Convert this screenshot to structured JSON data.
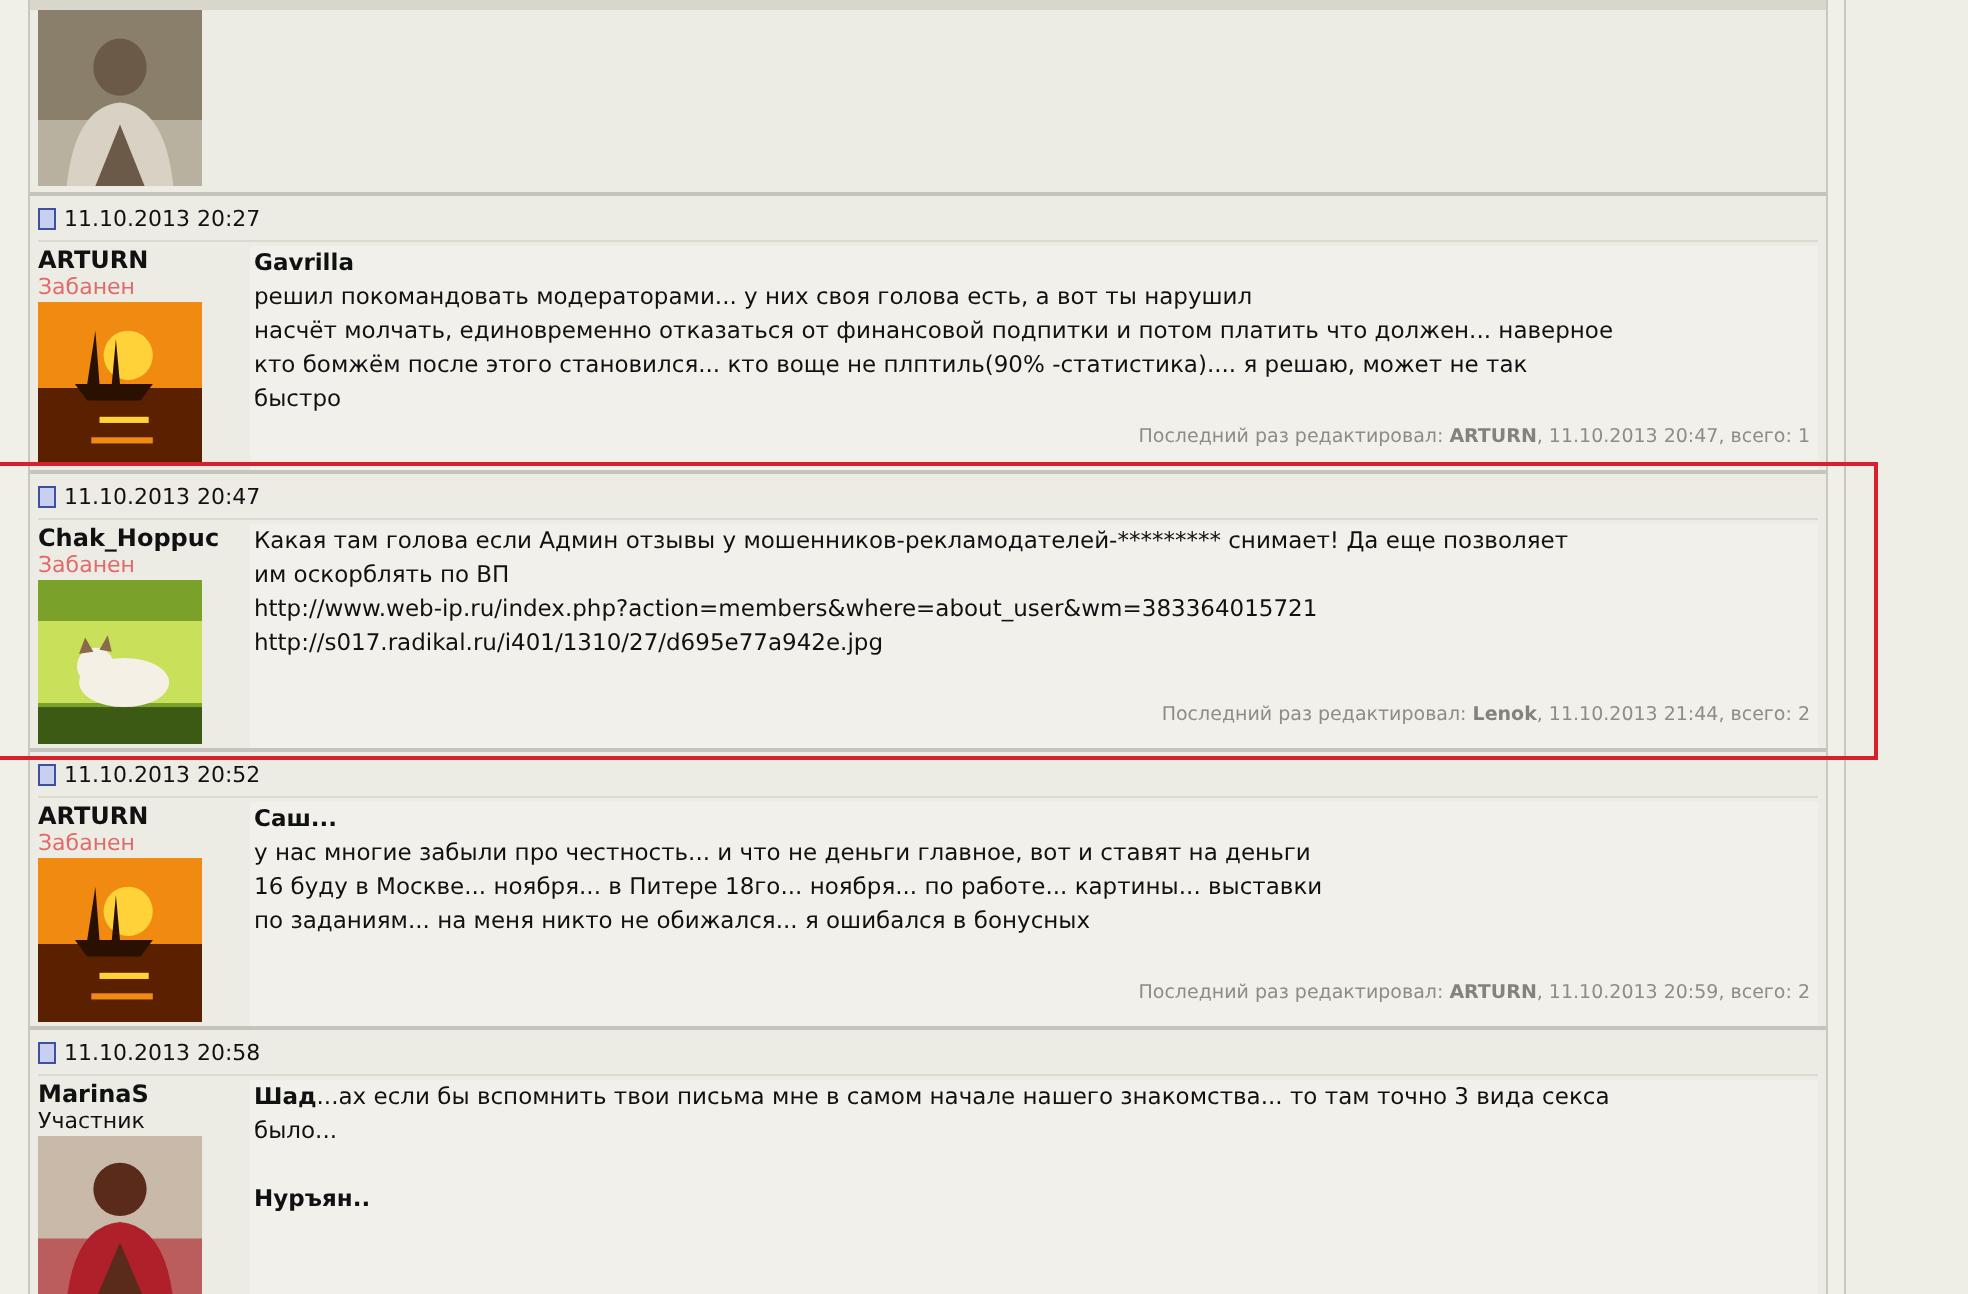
{
  "posts": [
    {
      "kind": "avatar_only"
    },
    {
      "kind": "post",
      "date": "11.10.2013 20:27",
      "author": "ARTURN",
      "rank": "Забанен",
      "banned": true,
      "highlighted": false,
      "message": [
        {
          "kind": "heading",
          "text": "Gavrilla"
        },
        {
          "kind": "text",
          "text": "решил покомандовать модераторами... у них своя голова есть, а вот ты нарушил\nнасчёт молчать, единовременно отказаться от финансовой подпитки и потом платить что должен... наверное\nкто бомжём после этого становился... кто воще не плптиль(90% -статистика).... я решаю, может не так\nбыстро"
        }
      ],
      "edited": "Последний раз редактировал: **ARTURN**, 11.10.2013 20:47, всего: 1"
    },
    {
      "kind": "post",
      "date": "11.10.2013 20:47",
      "author": "Chak_Hoppuc",
      "rank": "Забанен",
      "banned": true,
      "highlighted": true,
      "message": [
        {
          "kind": "text",
          "text": "Какая там голова если Админ отзывы у мошенников-рекламодателей-********* снимает! Да еще позволяет\nим оскорблять по ВП\nhttp://www.web-ip.ru/index.php?action=members&where=about_user&wm=383364015721\nhttp://s017.radikal.ru/i401/1310/27/d695e77a942e.jpg"
        }
      ],
      "edited": "Последний раз редактировал: **Lenok**, 11.10.2013 21:44, всего: 2"
    },
    {
      "kind": "post",
      "date": "11.10.2013 20:52",
      "author": "ARTURN",
      "rank": "Забанен",
      "banned": true,
      "highlighted": false,
      "message": [
        {
          "kind": "heading",
          "text": "Саш..."
        },
        {
          "kind": "text",
          "text": "у нас многие забыли про честность... и что не деньги главное, вот и ставят на деньги\n16 буду в Москве... ноября... в Питере 18го... ноября... по работе... картины... выставки\nпо заданиям... на меня никто не обижался... я ошибался в бонусных"
        }
      ],
      "edited": "Последний раз редактировал: **ARTURN**, 11.10.2013 20:59, всего: 2"
    },
    {
      "kind": "post",
      "date": "11.10.2013 20:58",
      "author": "MarinaS",
      "rank": "Участник",
      "banned": false,
      "highlighted": false,
      "message": [
        {
          "kind": "rich",
          "text": "**Шад**...ах если бы вспомнить твои письма мне в самом начале нашего знакомства... то там точно 3 вида секса\nбыло..."
        },
        {
          "kind": "heading",
          "text": "Нуръян.."
        }
      ]
    }
  ]
}
